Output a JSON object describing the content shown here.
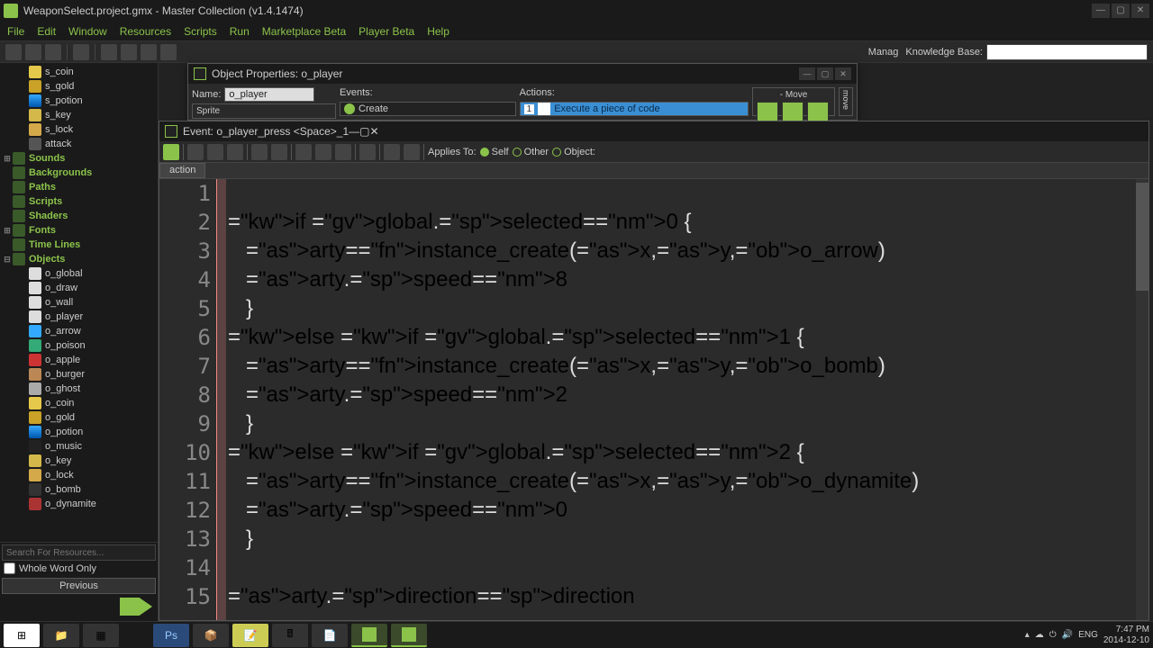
{
  "window": {
    "title": "WeaponSelect.project.gmx  -  Master Collection (v1.4.1474)"
  },
  "menu": {
    "file": "File",
    "edit": "Edit",
    "window_m": "Window",
    "resources": "Resources",
    "scripts": "Scripts",
    "run": "Run",
    "marketplace": "Marketplace Beta",
    "player": "Player Beta",
    "help": "Help"
  },
  "toolbar": {
    "manage": "Manag",
    "kb_label": "Knowledge Base:"
  },
  "tree": {
    "sprites": {
      "s_coin": "s_coin",
      "s_gold": "s_gold",
      "s_potion": "s_potion",
      "s_key": "s_key",
      "s_lock": "s_lock",
      "attack": "attack"
    },
    "folders": {
      "sounds": "Sounds",
      "backgrounds": "Backgrounds",
      "paths": "Paths",
      "scripts": "Scripts",
      "shaders": "Shaders",
      "fonts": "Fonts",
      "timelines": "Time Lines",
      "objects": "Objects"
    },
    "objects": {
      "o_global": "o_global",
      "o_draw": "o_draw",
      "o_wall": "o_wall",
      "o_player": "o_player",
      "o_arrow": "o_arrow",
      "o_poison": "o_poison",
      "o_apple": "o_apple",
      "o_burger": "o_burger",
      "o_ghost": "o_ghost",
      "o_coin": "o_coin",
      "o_gold": "o_gold",
      "o_potion": "o_potion",
      "o_music": "o_music",
      "o_key": "o_key",
      "o_lock": "o_lock",
      "o_bomb": "o_bomb",
      "o_dynamite": "o_dynamite"
    }
  },
  "search": {
    "placeholder": "Search For Resources...",
    "whole_word": "Whole Word Only",
    "previous": "Previous"
  },
  "obj_win": {
    "title": "Object Properties: o_player",
    "name_label": "Name:",
    "name_value": "o_player",
    "sprite_label": "Sprite",
    "events_label": "Events:",
    "event_create": "Create",
    "actions_label": "Actions:",
    "action_num": "1",
    "action_text": "Execute a piece of code",
    "move_label": "- Move",
    "move_tab": "move"
  },
  "code_win": {
    "title": "Event: o_player_press <Space>_1",
    "applies": "Applies To:",
    "self": "Self",
    "other": "Other",
    "object": "Object:",
    "tab": "action"
  },
  "code_lines": [
    "",
    "if global.selected=0 {",
    "   arty=instance_create(x,y,o_arrow)",
    "   arty.speed=8",
    "   }",
    "else if global.selected=1 {",
    "   arty=instance_create(x,y,o_bomb)",
    "   arty.speed=2",
    "   }",
    "else if global.selected=2 {",
    "   arty=instance_create(x,y,o_dynamite)",
    "   arty.speed=0",
    "   }",
    "",
    "arty.direction=direction"
  ],
  "taskbar": {
    "lang": "ENG",
    "time": "7:47 PM",
    "date": "2014-12-10"
  }
}
